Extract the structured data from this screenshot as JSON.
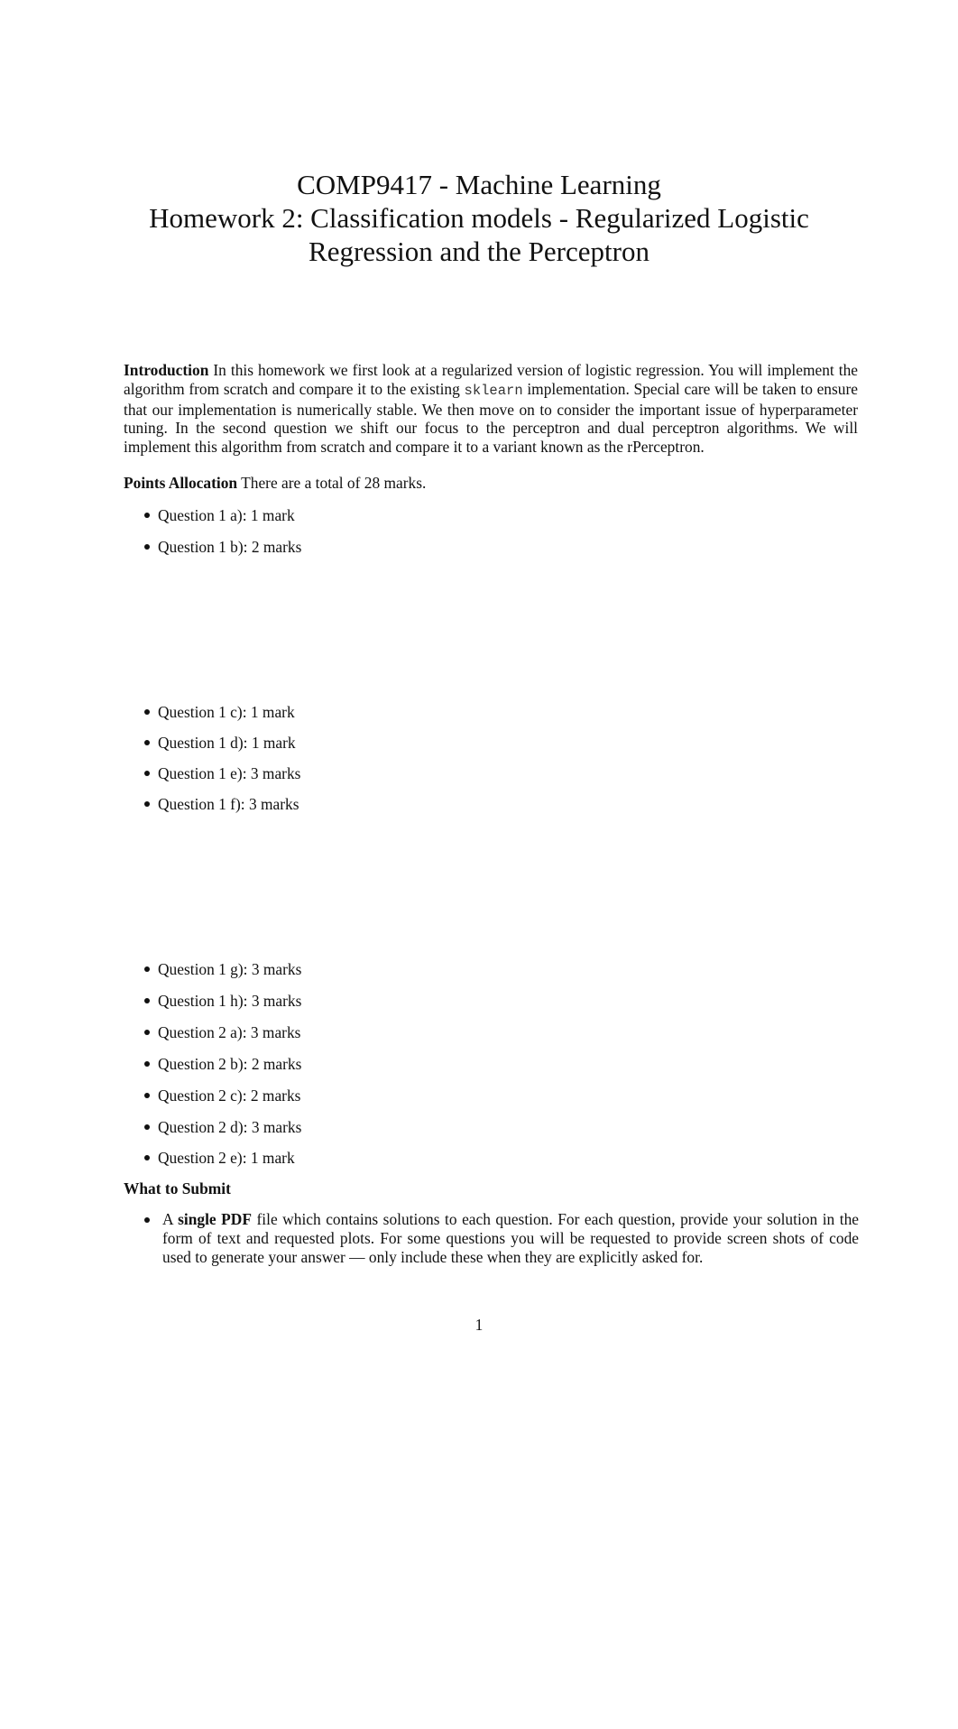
{
  "title": {
    "line1": "COMP9417 - Machine Learning",
    "line2": "Homework 2: Classification models - Regularized Logistic",
    "line3": "Regression and the Perceptron"
  },
  "introduction": {
    "heading": "Introduction",
    "text_before_code": " In this homework we first look at a regularized version of logistic regression. You will implement the algorithm from scratch and compare it to the existing ",
    "code": "sklearn",
    "text_after_code": " implementation. Special care will be taken to ensure that our implementation is numerically stable. We then move on to consider the important issue of hyperparameter tuning. In the second question we shift our focus to the perceptron and dual perceptron algorithms. We will implement this algorithm from scratch and compare it to a variant known as the rPerceptron."
  },
  "points_allocation": {
    "heading": "Points Allocation",
    "text": " There are a total of 28 marks.",
    "items": [
      "Question 1 a): 1 mark",
      "Question 1 b): 2 marks",
      "Question 1 c): 1 mark",
      "Question 1 d): 1 mark",
      "Question 1 e): 3 marks",
      "Question 1 f): 3 marks",
      "Question 1 g): 3 marks",
      "Question 1 h): 3 marks",
      "Question 2 a): 3 marks",
      "Question 2 b): 2 marks",
      "Question 2 c): 2 marks",
      "Question 2 d): 3 marks",
      "Question 2 e): 1 mark"
    ]
  },
  "what_to_submit": {
    "heading": "What to Submit",
    "item": {
      "prefix": "A ",
      "bold": "single PDF",
      "text": " file which contains solutions to each question. For each question, provide your solution in the form of text and requested plots. For some questions you will be requested to provide screen shots of code used to generate your answer — only include these when they are explicitly asked for."
    }
  },
  "page_number": "1"
}
